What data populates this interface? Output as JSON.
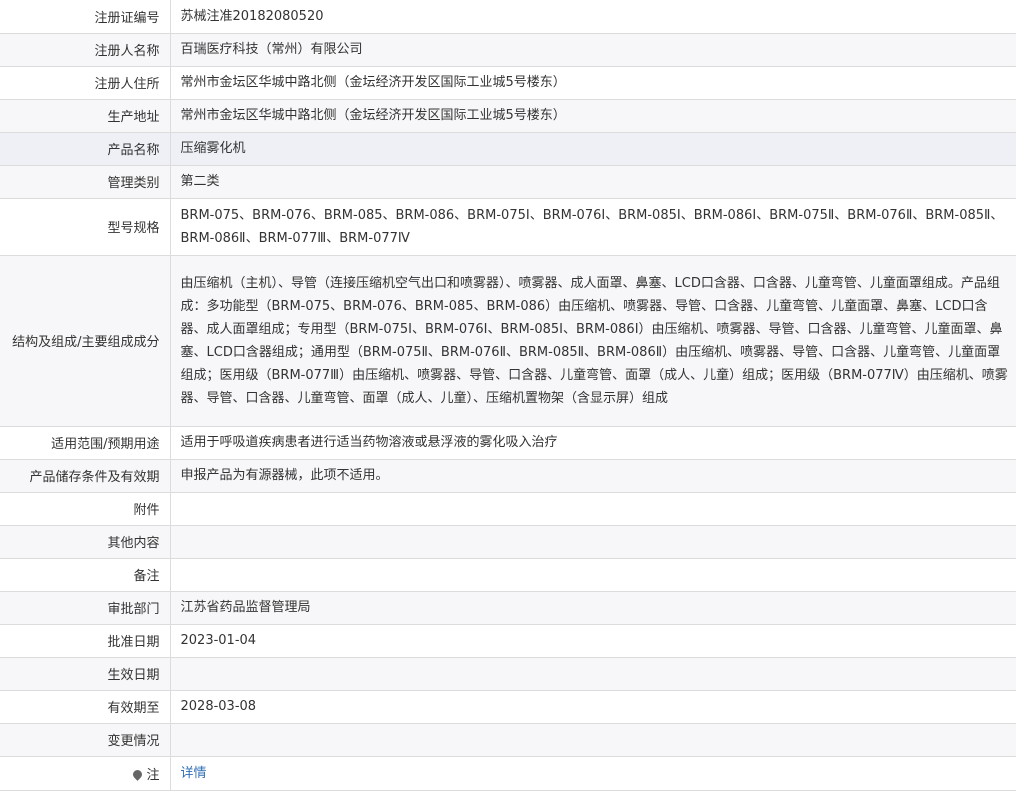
{
  "rows": [
    {
      "label": "注册证编号",
      "value": "苏械注准20182080520"
    },
    {
      "label": "注册人名称",
      "value": "百瑞医疗科技（常州）有限公司"
    },
    {
      "label": "注册人住所",
      "value": "常州市金坛区华城中路北侧（金坛经济开发区国际工业城5号楼东）"
    },
    {
      "label": "生产地址",
      "value": "常州市金坛区华城中路北侧（金坛经济开发区国际工业城5号楼东）"
    },
    {
      "label": "产品名称",
      "value": "压缩雾化机"
    },
    {
      "label": "管理类别",
      "value": "第二类"
    },
    {
      "label": "型号规格",
      "value": "BRM-075、BRM-076、BRM-085、BRM-086、BRM-075Ⅰ、BRM-076Ⅰ、BRM-085Ⅰ、BRM-086Ⅰ、BRM-075Ⅱ、BRM-076Ⅱ、BRM-085Ⅱ、BRM-086Ⅱ、BRM-077Ⅲ、BRM-077Ⅳ"
    },
    {
      "label": "结构及组成/主要组成成分",
      "value": "由压缩机（主机）、导管（连接压缩机空气出口和喷雾器）、喷雾器、成人面罩、鼻塞、LCD口含器、口含器、儿童弯管、儿童面罩组成。产品组成：多功能型（BRM-075、BRM-076、BRM-085、BRM-086）由压缩机、喷雾器、导管、口含器、儿童弯管、儿童面罩、鼻塞、LCD口含器、成人面罩组成；专用型（BRM-075Ⅰ、BRM-076Ⅰ、BRM-085Ⅰ、BRM-086Ⅰ）由压缩机、喷雾器、导管、口含器、儿童弯管、儿童面罩、鼻塞、LCD口含器组成；通用型（BRM-075Ⅱ、BRM-076Ⅱ、BRM-085Ⅱ、BRM-086Ⅱ）由压缩机、喷雾器、导管、口含器、儿童弯管、儿童面罩组成；医用级（BRM-077Ⅲ）由压缩机、喷雾器、导管、口含器、儿童弯管、面罩（成人、儿童）组成；医用级（BRM-077Ⅳ）由压缩机、喷雾器、导管、口含器、儿童弯管、面罩（成人、儿童）、压缩机置物架（含显示屏）组成"
    },
    {
      "label": "适用范围/预期用途",
      "value": "适用于呼吸道疾病患者进行适当药物溶液或悬浮液的雾化吸入治疗"
    },
    {
      "label": "产品储存条件及有效期",
      "value": "申报产品为有源器械，此项不适用。"
    },
    {
      "label": "附件",
      "value": ""
    },
    {
      "label": "其他内容",
      "value": ""
    },
    {
      "label": "备注",
      "value": ""
    },
    {
      "label": "审批部门",
      "value": "江苏省药品监督管理局"
    },
    {
      "label": "批准日期",
      "value": "2023-01-04"
    },
    {
      "label": "生效日期",
      "value": ""
    },
    {
      "label": "有效期至",
      "value": "2028-03-08"
    },
    {
      "label": "变更情况",
      "value": ""
    }
  ],
  "note": {
    "label": "注",
    "link": "详情",
    "icon": "pin-icon"
  }
}
